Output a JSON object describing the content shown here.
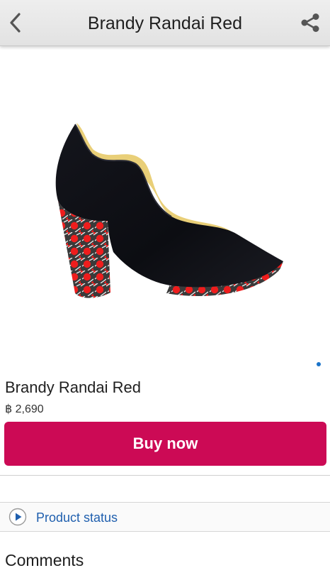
{
  "appbar": {
    "title": "Brandy Randai Red",
    "back_icon": "chevron-left-icon",
    "share_icon": "share-icon"
  },
  "carousel": {
    "image_name": "red-patterned-platform-pump-image",
    "page_count": 1,
    "current_page": 1
  },
  "product": {
    "name": "Brandy Randai Red",
    "price": "฿ 2,690",
    "buy_label": "Buy now"
  },
  "status": {
    "icon": "play-circle-icon",
    "label": "Product status"
  },
  "comments": {
    "heading": "Comments"
  },
  "colors": {
    "accent": "#cc0a55",
    "link": "#1f5fae",
    "page_indicator": "#1a73c9"
  }
}
